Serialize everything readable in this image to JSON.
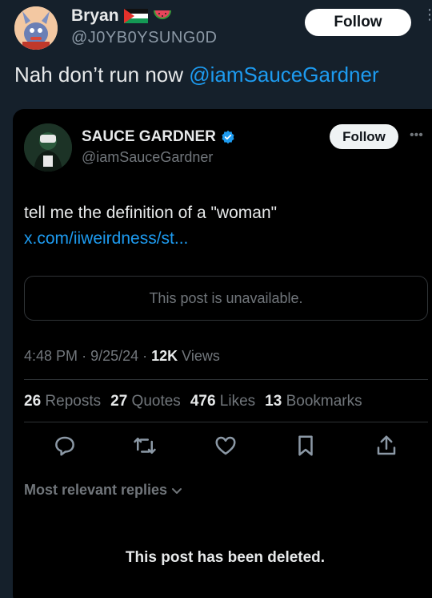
{
  "outer": {
    "name": "Bryan",
    "handle": "@J0YB0YSUNG0D",
    "follow_label": "Follow",
    "text": "Nah don’t run now ",
    "mention": "@iamSauceGardner"
  },
  "quoted": {
    "name": "SAUCE GARDNER",
    "handle": "@iamSauceGardner",
    "follow_label": "Follow",
    "text": "tell me the definition of a \"woman\" ",
    "link": "x.com/iiweirdness/st...",
    "unavailable": "This post is unavailable.",
    "time": "4:48 PM",
    "date": "9/25/24",
    "views_count": "12K",
    "views_label": " Views",
    "reposts_count": "26",
    "reposts_label": " Reposts",
    "quotes_count": "27",
    "quotes_label": " Quotes",
    "likes_count": "476",
    "likes_label": " Likes",
    "bookmarks_count": "13",
    "bookmarks_label": " Bookmarks"
  },
  "replies": {
    "sort_label": "Most relevant replies",
    "deleted_text": "This post has been deleted."
  },
  "colors": {
    "background": "#15202b",
    "card": "#000000",
    "accent": "#1d9bf0",
    "muted": "#71767b"
  },
  "icons": [
    "flag-icon",
    "watermelon-icon",
    "verified-icon",
    "reply-icon",
    "repost-icon",
    "like-icon",
    "bookmark-icon",
    "share-icon",
    "chevron-down-icon",
    "more-icon"
  ]
}
